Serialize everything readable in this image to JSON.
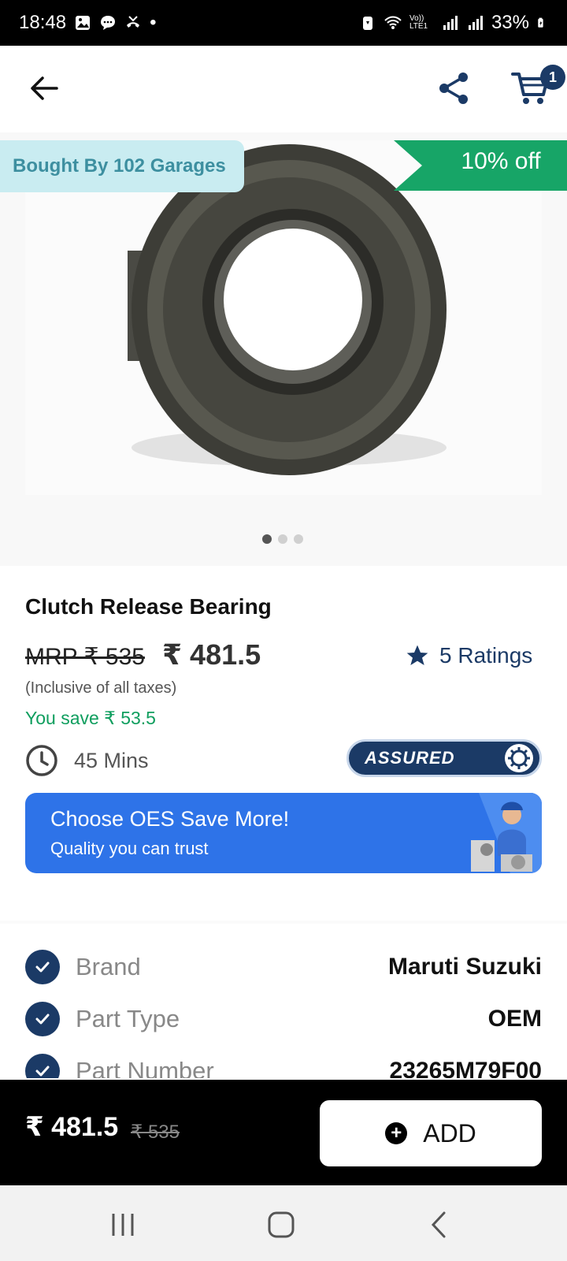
{
  "status_bar": {
    "time": "18:48",
    "dot": "•",
    "network": "Vo)) LTE1",
    "battery": "33%"
  },
  "app_bar": {
    "cart_count": "1"
  },
  "product_image": {
    "bought_by": "Bought By 102 Garages",
    "discount": "10% off",
    "slides": [
      true,
      false,
      false
    ]
  },
  "product": {
    "name": "Clutch Release Bearing",
    "mrp": "MRP ₹ 535",
    "price": "₹ 481.5",
    "ratings": "5 Ratings",
    "tax_note": "(Inclusive of all taxes)",
    "savings": "You save ₹ 53.5",
    "delivery_time": "45 Mins",
    "assured": "ASSURED"
  },
  "banner": {
    "title": "Choose OES Save More!",
    "subtitle": "Quality you can trust"
  },
  "specs": [
    {
      "label": "Brand",
      "value": "Maruti Suzuki"
    },
    {
      "label": "Part Type",
      "value": "OEM"
    },
    {
      "label": "Part Number",
      "value": "23265M79F00"
    }
  ],
  "bottom_bar": {
    "price": "₹ 481.5",
    "mrp": "₹ 535",
    "add_label": "ADD"
  },
  "colors": {
    "primary": "#1b3a66",
    "green": "#0f9e5e",
    "badge_bg": "#c9ecf1",
    "banner_blue": "#2e73e8"
  }
}
